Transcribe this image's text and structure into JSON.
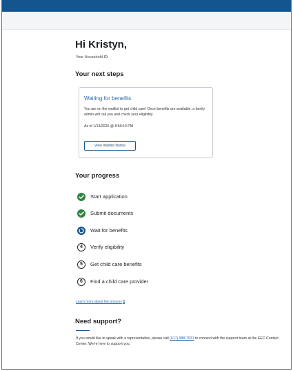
{
  "greeting": "Hi Kristyn,",
  "household_id_label": "Your Household ID:",
  "next_steps": {
    "heading": "Your next steps",
    "card_title": "Waiting for benefits",
    "card_body": "You are on the waitlist to get child care! Once benefits are available, a family admin will call you and check your eligibility.",
    "card_date": "As of 1/13/2026 @ 8:50:10 PM",
    "card_button": "View Waitlist Notice"
  },
  "progress": {
    "heading": "Your progress",
    "steps": [
      {
        "label": "Start application",
        "status": "complete"
      },
      {
        "label": "Submit documents",
        "status": "complete"
      },
      {
        "label": "Wait for benefits",
        "status": "current"
      },
      {
        "label": "Verify eligibility",
        "status": "upcoming",
        "number": "4"
      },
      {
        "label": "Get child care benefits",
        "status": "upcoming",
        "number": "5"
      },
      {
        "label": "Find a child care provider",
        "status": "upcoming",
        "number": "6"
      }
    ],
    "learn_more": "Learn more about the process"
  },
  "support": {
    "heading": "Need support?",
    "text_before": "If you would like to speak with a representative, please call ",
    "phone": "(617) 988-7931",
    "text_after": " to connect with the support team at the EEC Contact Center. We're here to support you."
  },
  "colors": {
    "header_blue": "#14558f",
    "complete_green": "#2e8540",
    "link_blue": "#2f6aad"
  },
  "icons": {
    "complete": "check-circle-icon",
    "current": "spinner-circle-icon",
    "external": "external-link-icon"
  }
}
